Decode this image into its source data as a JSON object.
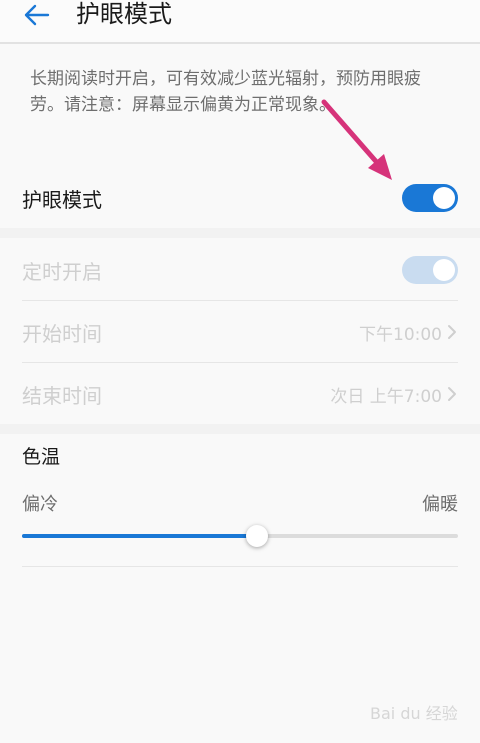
{
  "header": {
    "title": "护眼模式",
    "back_icon": "arrow-left-icon"
  },
  "description": "长期阅读时开启，可有效减少蓝光辐射，预防用眼疲劳。请注意：屏幕显示偏黄为正常现象。",
  "eye_mode": {
    "label": "护眼模式",
    "enabled": true
  },
  "schedule": {
    "label": "定时开启",
    "enabled": true,
    "start": {
      "label": "开始时间",
      "value": "下午10:00"
    },
    "end": {
      "label": "结束时间",
      "value": "次日 上午7:00"
    }
  },
  "color_temperature": {
    "title": "色温",
    "min_label": "偏冷",
    "max_label": "偏暖",
    "value_fraction": 0.54
  },
  "colors": {
    "accent": "#1a78d6",
    "accent_disabled": "#c9dcf0",
    "annotation_arrow": "#d6337a"
  },
  "watermark": "Bai du 经验"
}
